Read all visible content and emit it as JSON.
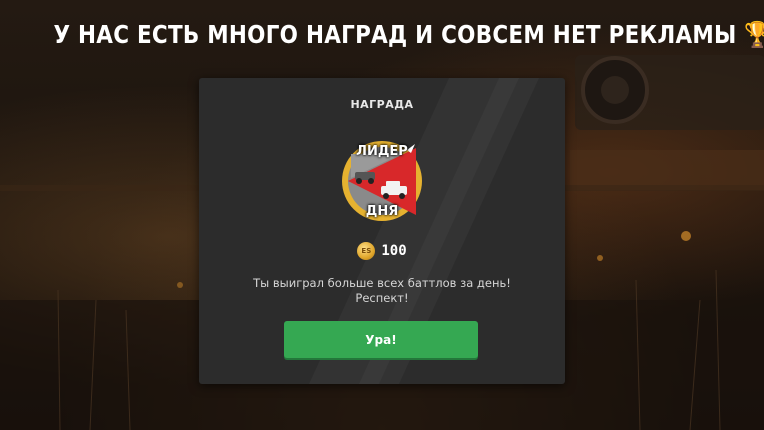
{
  "headline": {
    "text": "У НАС ЕСТЬ МНОГО НАГРАД И СОВСЕМ НЕТ РЕКЛАМЫ",
    "trophy": "🏆"
  },
  "dialog": {
    "title": "НАГРАДА",
    "badge": {
      "top_text": "ЛИДЕР",
      "bottom_text": "ДНЯ",
      "icon": "car-battle-badge-icon"
    },
    "reward": {
      "coin_label": "ES",
      "amount": "100"
    },
    "message_line1": "Ты выиграл больше всех баттлов за день!",
    "message_line2": "Респект!",
    "button_label": "Ура!"
  },
  "colors": {
    "dialog_bg": "#2c2c2c",
    "button_green": "#35a852",
    "badge_red": "#d8282a",
    "badge_gold": "#e6b230"
  }
}
